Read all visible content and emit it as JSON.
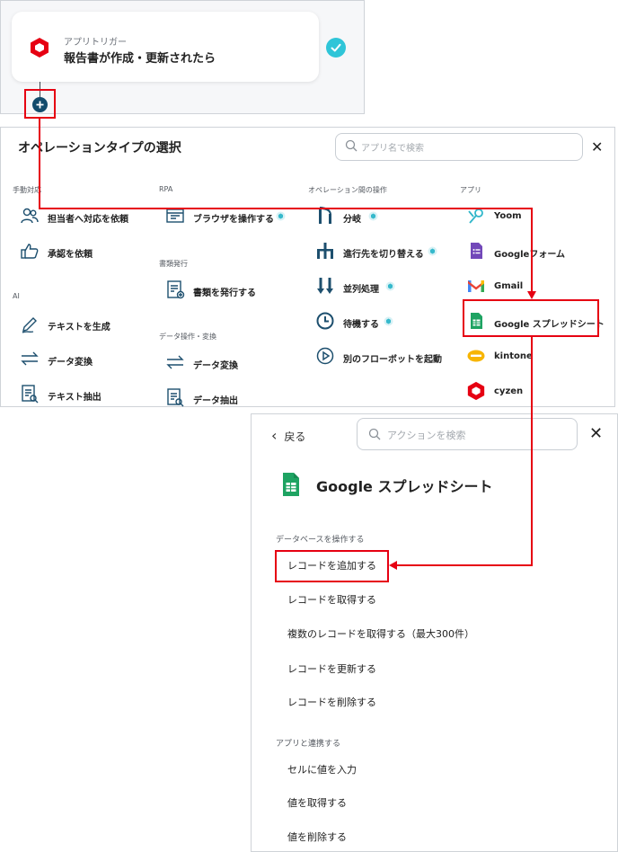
{
  "trigger": {
    "subtitle": "アプリトリガー",
    "title": "報告書が作成・更新されたら"
  },
  "operation_panel": {
    "title": "オペレーションタイプの選択",
    "search_placeholder": "アプリ名で検索",
    "columns": [
      {
        "header": "手動対応",
        "items": [
          "担当者へ対応を依頼",
          "承認を依頼"
        ]
      },
      {
        "header": "AI",
        "items": [
          "テキストを生成",
          "データ変換",
          "テキスト抽出"
        ]
      },
      {
        "header": "RPA",
        "items": [
          "ブラウザを操作する"
        ]
      },
      {
        "header": "書類発行",
        "items": [
          "書類を発行する"
        ]
      },
      {
        "header": "データ操作・変換",
        "items": [
          "データ変換",
          "データ抽出"
        ]
      },
      {
        "header": "オペレーション間の操作",
        "items": [
          "分岐",
          "進行先を切り替える",
          "並列処理",
          "待機する",
          "別のフローボットを起動"
        ]
      },
      {
        "header": "アプリ",
        "items": [
          "Yoom",
          "Googleフォーム",
          "Gmail",
          "Google スプレッドシート",
          "kintone",
          "cyzen"
        ]
      }
    ]
  },
  "action_panel": {
    "back_label": "戻る",
    "search_placeholder": "アクションを検索",
    "app_title": "Google スプレッドシート",
    "sections": [
      {
        "header": "データベースを操作する",
        "actions": [
          "レコードを追加する",
          "レコードを取得する",
          "複数のレコードを取得する（最大300件）",
          "レコードを更新する",
          "レコードを削除する"
        ]
      },
      {
        "header": "アプリと連携する",
        "actions": [
          "セルに値を入力",
          "値を取得する",
          "値を削除する"
        ]
      }
    ]
  },
  "colors": {
    "highlight": "#e60012",
    "check": "#2fc5d8",
    "plus": "#124b6c",
    "icon": "#1d4f6e",
    "sheets_green": "#1ea362",
    "badge": "#36b9cc"
  },
  "icons": {
    "trigger": "cyzen-logo-icon",
    "check": "check-icon",
    "plus": "plus-icon",
    "search": "search-icon",
    "close": "close-icon",
    "back": "chevron-left-icon",
    "badge": "premium-badge-icon"
  }
}
